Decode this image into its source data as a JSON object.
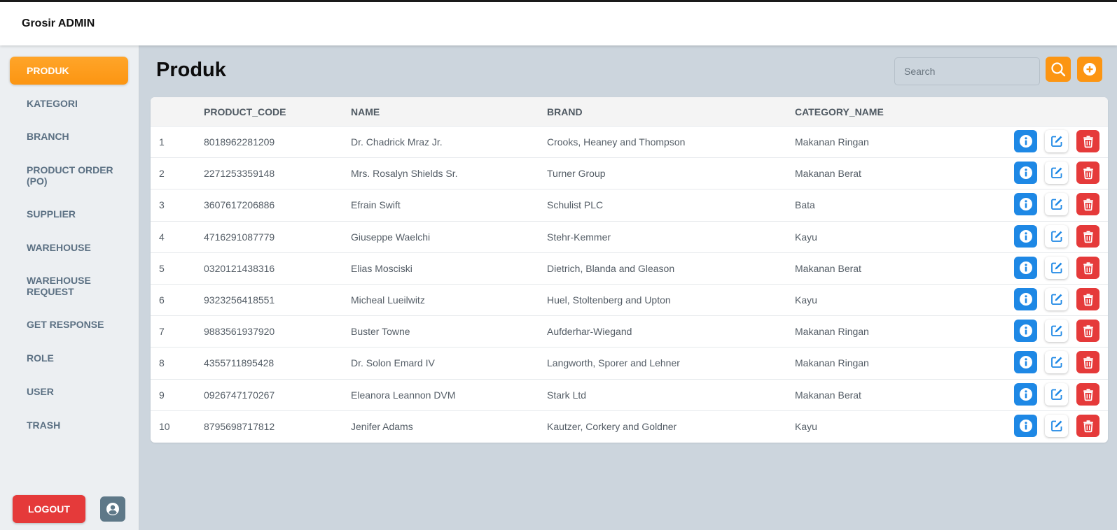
{
  "header": {
    "brand": "Grosir ADMIN"
  },
  "sidebar": {
    "items": [
      {
        "label": "PRODUK",
        "active": true
      },
      {
        "label": "KATEGORI"
      },
      {
        "label": "BRANCH"
      },
      {
        "label": "PRODUCT ORDER (PO)"
      },
      {
        "label": "SUPPLIER"
      },
      {
        "label": "WAREHOUSE"
      },
      {
        "label": "WAREHOUSE REQUEST"
      },
      {
        "label": "GET RESPONSE"
      },
      {
        "label": "ROLE"
      },
      {
        "label": "USER"
      },
      {
        "label": "TRASH"
      }
    ],
    "logout_label": "LOGOUT",
    "avatar_icon": "user-circle-icon"
  },
  "main": {
    "title": "Produk",
    "search": {
      "placeholder": "Search",
      "value": ""
    },
    "search_icon": "search-icon",
    "add_icon": "plus-circle-icon"
  },
  "table": {
    "columns": [
      "",
      "PRODUCT_CODE",
      "NAME",
      "BRAND",
      "CATEGORY_NAME"
    ],
    "rows": [
      {
        "no": "1",
        "product_code": "8018962281209",
        "name": "Dr. Chadrick Mraz Jr.",
        "brand": "Crooks, Heaney and Thompson",
        "category_name": "Makanan Ringan"
      },
      {
        "no": "2",
        "product_code": "2271253359148",
        "name": "Mrs. Rosalyn Shields Sr.",
        "brand": "Turner Group",
        "category_name": "Makanan Berat"
      },
      {
        "no": "3",
        "product_code": "3607617206886",
        "name": "Efrain Swift",
        "brand": "Schulist PLC",
        "category_name": "Bata"
      },
      {
        "no": "4",
        "product_code": "4716291087779",
        "name": "Giuseppe Waelchi",
        "brand": "Stehr-Kemmer",
        "category_name": "Kayu"
      },
      {
        "no": "5",
        "product_code": "0320121438316",
        "name": "Elias Mosciski",
        "brand": "Dietrich, Blanda and Gleason",
        "category_name": "Makanan Berat"
      },
      {
        "no": "6",
        "product_code": "9323256418551",
        "name": "Micheal Lueilwitz",
        "brand": "Huel, Stoltenberg and Upton",
        "category_name": "Kayu"
      },
      {
        "no": "7",
        "product_code": "9883561937920",
        "name": "Buster Towne",
        "brand": "Aufderhar-Wiegand",
        "category_name": "Makanan Ringan"
      },
      {
        "no": "8",
        "product_code": "4355711895428",
        "name": "Dr. Solon Emard IV",
        "brand": "Langworth, Sporer and Lehner",
        "category_name": "Makanan Ringan"
      },
      {
        "no": "9",
        "product_code": "0926747170267",
        "name": "Eleanora Leannon DVM",
        "brand": "Stark Ltd",
        "category_name": "Makanan Berat"
      },
      {
        "no": "10",
        "product_code": "8795698717812",
        "name": "Jenifer Adams",
        "brand": "Kautzer, Corkery and Goldner",
        "category_name": "Kayu"
      }
    ],
    "row_action_icons": [
      "info-icon",
      "edit-icon",
      "trash-icon"
    ]
  },
  "colors": {
    "accent": "#fc9512",
    "info": "#1e88e5",
    "danger": "#e53a3a",
    "background": "#ccd5dd",
    "sidebar": "#eceff2"
  }
}
